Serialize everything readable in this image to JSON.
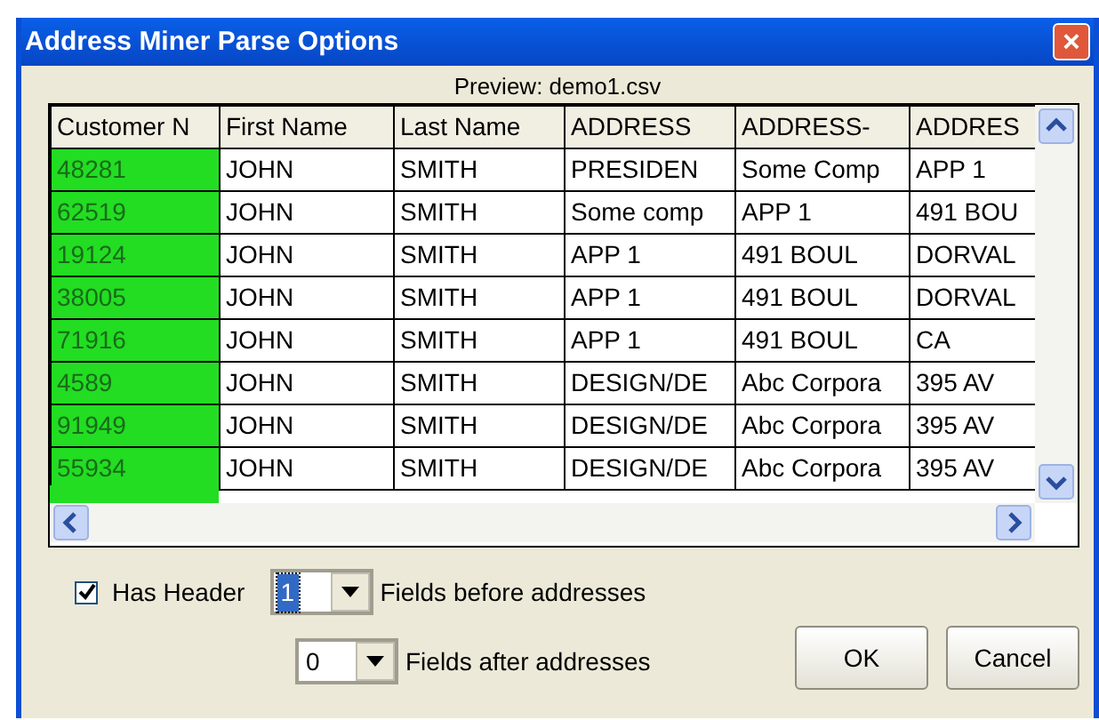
{
  "window": {
    "title": "Address Miner Parse Options",
    "close_glyph": "×"
  },
  "preview_label": "Preview: demo1.csv",
  "table": {
    "columns": [
      {
        "label": "Customer N",
        "highlighted": true
      },
      {
        "label": "First Name",
        "highlighted": false
      },
      {
        "label": "Last Name",
        "highlighted": false
      },
      {
        "label": "ADDRESS",
        "highlighted": false
      },
      {
        "label": "ADDRESS-",
        "highlighted": false
      },
      {
        "label": "ADDRES",
        "highlighted": false
      }
    ],
    "rows": [
      [
        "48281",
        "JOHN",
        "SMITH",
        "PRESIDEN",
        "Some Comp",
        "APP 1"
      ],
      [
        "62519",
        "JOHN",
        "SMITH",
        "Some comp",
        "APP 1",
        "491 BOU"
      ],
      [
        "19124",
        "JOHN",
        "SMITH",
        "APP 1",
        "491 BOUL",
        "DORVAL"
      ],
      [
        "38005",
        "JOHN",
        "SMITH",
        "APP 1",
        "491 BOUL",
        "DORVAL"
      ],
      [
        "71916",
        "JOHN",
        "SMITH",
        "APP 1",
        "491 BOUL",
        "CA"
      ],
      [
        "4589",
        "JOHN",
        "SMITH",
        "DESIGN/DE",
        "Abc Corpora",
        "395 AV"
      ],
      [
        "91949",
        "JOHN",
        "SMITH",
        "DESIGN/DE",
        "Abc Corpora",
        "395 AV"
      ],
      [
        "55934",
        "JOHN",
        "SMITH",
        "DESIGN/DE",
        "Abc Corpora",
        "395 AV"
      ]
    ]
  },
  "has_header": {
    "label": "Has Header",
    "checked": true
  },
  "fields_before": {
    "value": "1",
    "selected": true,
    "label": "Fields before addresses"
  },
  "fields_after": {
    "value": "0",
    "selected": false,
    "label": "Fields after addresses"
  },
  "buttons": [
    "OK",
    "Cancel"
  ]
}
